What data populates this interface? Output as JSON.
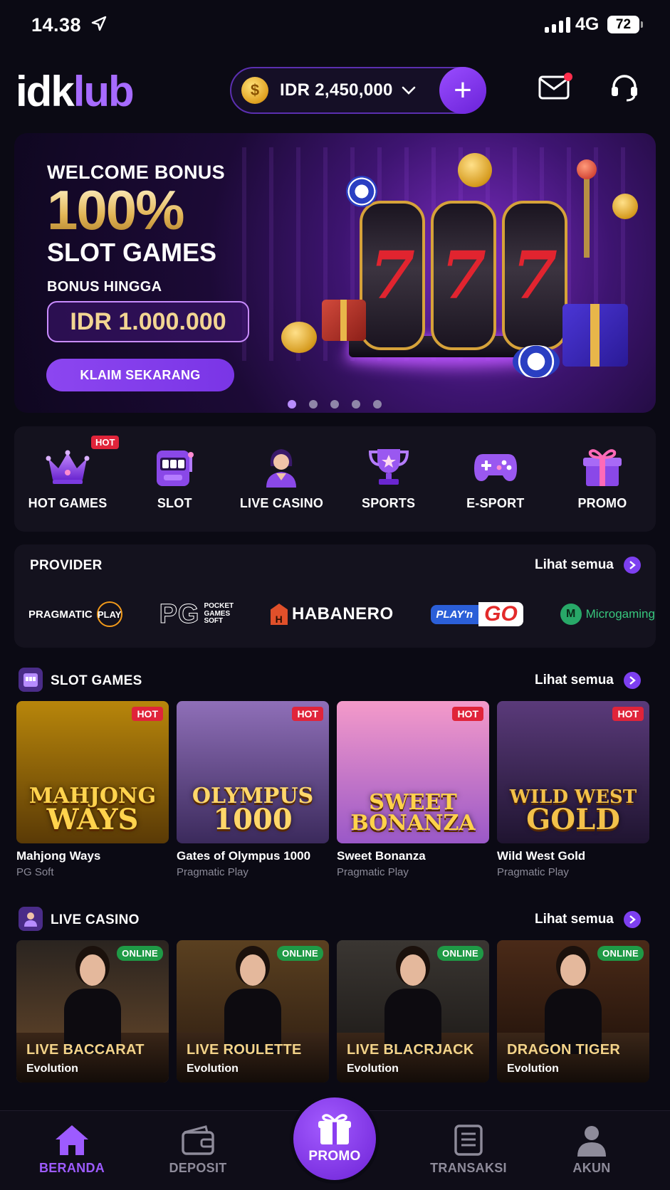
{
  "status": {
    "time": "14.38",
    "network": "4G",
    "battery": "72"
  },
  "header": {
    "logo_main": "idk",
    "logo_accent": "lub",
    "balance": "IDR 2,450,000",
    "add_label": "+"
  },
  "banner": {
    "welcome": "WELCOME BONUS",
    "percent": "100%",
    "slot": "SLOT GAMES",
    "upto": "BONUS HINGGA",
    "amount": "IDR 1.000.000",
    "cta": "KLAIM SEKARANG",
    "reel_symbol": "7",
    "dots_total": 5,
    "active_dot": 1
  },
  "categories": [
    {
      "label": "HOT GAMES",
      "icon": "crown-icon",
      "badge": "HOT"
    },
    {
      "label": "SLOT",
      "icon": "slot-machine-icon"
    },
    {
      "label": "LIVE CASINO",
      "icon": "dealer-icon"
    },
    {
      "label": "SPORTS",
      "icon": "trophy-icon"
    },
    {
      "label": "E-SPORT",
      "icon": "gamepad-icon"
    },
    {
      "label": "PROMO",
      "icon": "gift-icon"
    }
  ],
  "provider": {
    "title": "PROVIDER",
    "see_all": "Lihat semua",
    "logos": {
      "pragmatic": "PRAGMATIC",
      "pragmatic_play": "PLAY",
      "pg": "PG",
      "pg_sub1": "POCKET",
      "pg_sub2": "GAMES",
      "pg_sub3": "SOFT",
      "habanero": "HABANERO",
      "playngo_a": "PLAY'n",
      "playngo_b": "GO",
      "microgaming": "Microgaming"
    }
  },
  "slot_games": {
    "title": "SLOT GAMES",
    "see_all": "Lihat semua",
    "items": [
      {
        "title": "Mahjong Ways",
        "provider": "PG Soft",
        "badge": "HOT",
        "art_line1": "MAHJONG",
        "art_line2": "WAYS",
        "colors": [
          "#b8860b",
          "#5a3a06"
        ],
        "text_color": "#ffd34d"
      },
      {
        "title": "Gates of Olympus 1000",
        "provider": "Pragmatic Play",
        "badge": "HOT",
        "art_line1": "OLYMPUS",
        "art_line2": "1000",
        "colors": [
          "#8f6fb8",
          "#3b2a5c"
        ],
        "text_color": "#ffd76a"
      },
      {
        "title": "Sweet Bonanza",
        "provider": "Pragmatic Play",
        "badge": "HOT",
        "art_line1": "SWEET",
        "art_line2": "BONANZA",
        "colors": [
          "#f49ac9",
          "#9a58c8"
        ],
        "text_color": "#ffd24a"
      },
      {
        "title": "Wild West Gold",
        "provider": "Pragmatic Play",
        "badge": "HOT",
        "art_line1": "WILD WEST",
        "art_line2": "GOLD",
        "colors": [
          "#5a3a7a",
          "#1f1430"
        ],
        "text_color": "#f2c14a"
      }
    ]
  },
  "live_casino": {
    "title": "LIVE CASINO",
    "see_all": "Lihat semua",
    "items": [
      {
        "name": "LIVE BACCARAT",
        "provider": "Evolution",
        "badge": "ONLINE"
      },
      {
        "name": "LIVE ROULETTE",
        "provider": "Evolution",
        "badge": "ONLINE"
      },
      {
        "name": "LIVE BLACRJACK",
        "provider": "Evolution",
        "badge": "ONLINE"
      },
      {
        "name": "DRAGON TIGER",
        "provider": "Evolution",
        "badge": "ONLINE"
      }
    ]
  },
  "nav": {
    "home": "BERANDA",
    "deposit": "DEPOSIT",
    "promo": "PROMO",
    "transactions": "TRANSAKSI",
    "account": "AKUN"
  },
  "colors": {
    "accent": "#7d3ff0",
    "hot": "#e0243a",
    "online": "#1f9a46",
    "bg": "#0b0a14"
  }
}
